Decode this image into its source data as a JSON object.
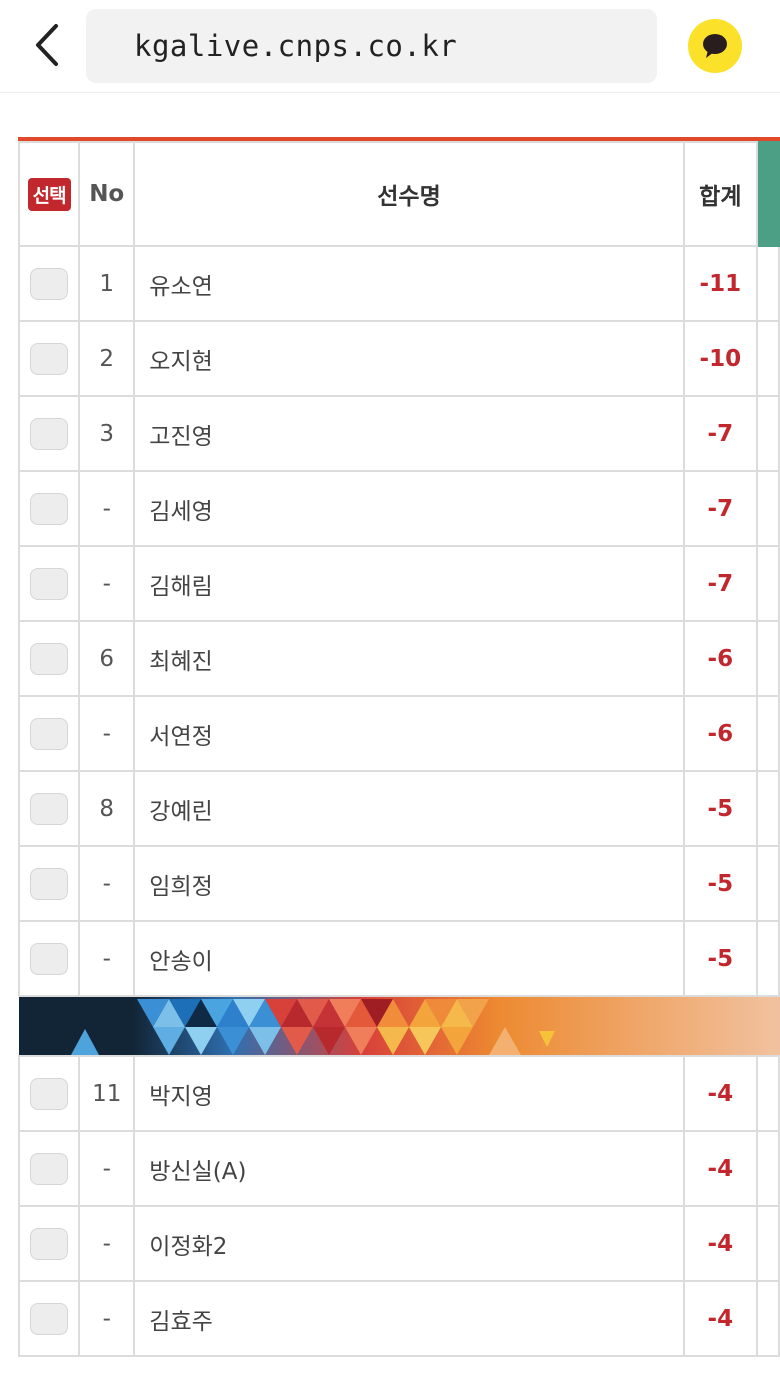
{
  "browser": {
    "url": "kgalive.cnps.co.kr",
    "back_icon": "chevron-left-icon",
    "chat_icon": "kakaotalk-chat-icon",
    "chat_color": "#fce12a"
  },
  "table": {
    "accent_color": "#e04a2a",
    "header": {
      "select": "선택",
      "no": "No",
      "name": "선수명",
      "total": "합계"
    },
    "rows_top": [
      {
        "no": "1",
        "name": "유소연",
        "total": "-11"
      },
      {
        "no": "2",
        "name": "오지현",
        "total": "-10"
      },
      {
        "no": "3",
        "name": "고진영",
        "total": "-7"
      },
      {
        "no": "-",
        "name": "김세영",
        "total": "-7"
      },
      {
        "no": "-",
        "name": "김해림",
        "total": "-7"
      },
      {
        "no": "6",
        "name": "최혜진",
        "total": "-6"
      },
      {
        "no": "-",
        "name": "서연정",
        "total": "-6"
      },
      {
        "no": "8",
        "name": "강예린",
        "total": "-5"
      },
      {
        "no": "-",
        "name": "임희정",
        "total": "-5"
      },
      {
        "no": "-",
        "name": "안송이",
        "total": "-5"
      }
    ],
    "rows_bottom": [
      {
        "no": "11",
        "name": "박지영",
        "total": "-4"
      },
      {
        "no": "-",
        "name": "방신실(A)",
        "total": "-4"
      },
      {
        "no": "-",
        "name": "이정화2",
        "total": "-4"
      },
      {
        "no": "-",
        "name": "김효주",
        "total": "-4"
      }
    ],
    "score_color": "#c1272d"
  }
}
